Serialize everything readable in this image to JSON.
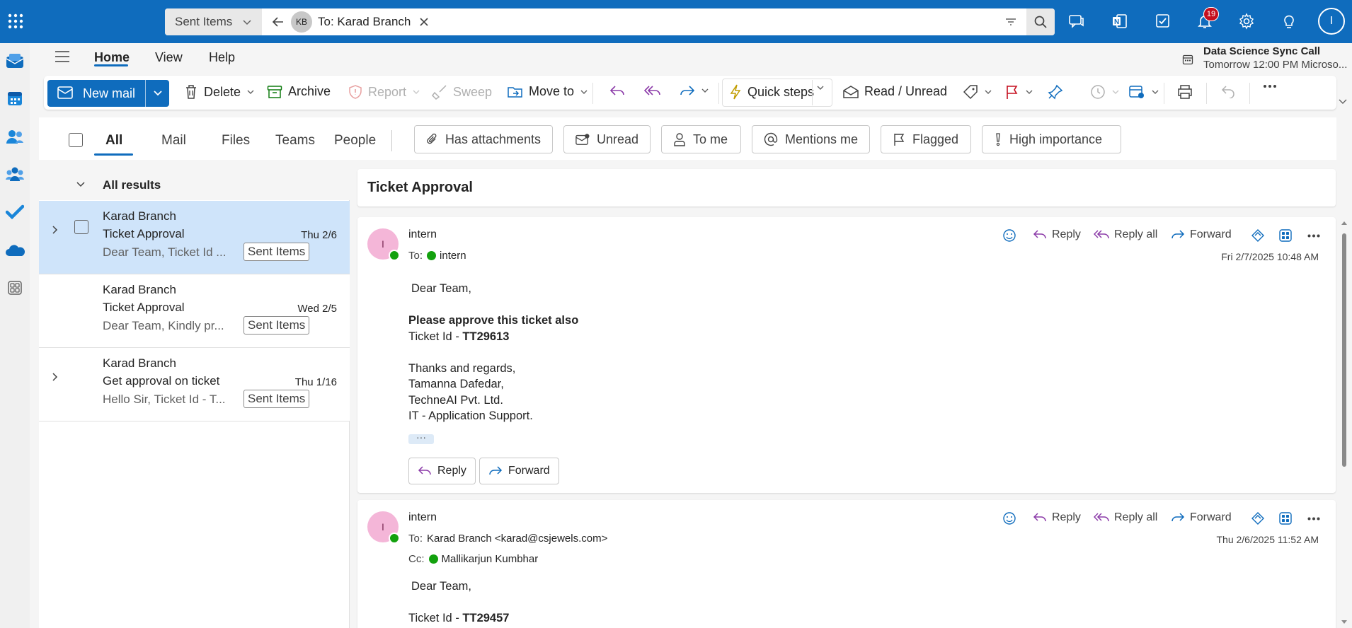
{
  "search": {
    "scope": "Sent Items",
    "chip_initials": "KB",
    "chip_label": "To: Karad Branch"
  },
  "notifications": {
    "count": "19"
  },
  "account": {
    "initial": "I"
  },
  "ribbon_tabs": [
    "Home",
    "View",
    "Help"
  ],
  "meeting": {
    "title": "Data Science Sync Call",
    "time": "Tomorrow 12:00 PM Microso..."
  },
  "ribbon": {
    "new_mail": "New mail",
    "delete": "Delete",
    "archive": "Archive",
    "report": "Report",
    "sweep": "Sweep",
    "move_to": "Move to",
    "quick_steps": "Quick steps",
    "read_unread": "Read / Unread"
  },
  "filter_tabs": [
    "All",
    "Mail",
    "Files",
    "Teams",
    "People"
  ],
  "filter_pills": [
    "Has attachments",
    "Unread",
    "To me",
    "Mentions me",
    "Flagged",
    "High importance"
  ],
  "list": {
    "header": "All results",
    "items": [
      {
        "from": "Karad Branch",
        "subject": "Ticket Approval",
        "date": "Thu 2/6",
        "preview": "Dear Team, Ticket Id ...",
        "folder": "Sent Items",
        "selected": true
      },
      {
        "from": "Karad Branch",
        "subject": "Ticket Approval",
        "date": "Wed 2/5",
        "preview": "Dear Team, Kindly pr...",
        "folder": "Sent Items",
        "selected": false
      },
      {
        "from": "Karad Branch",
        "subject": "Get approval on ticket",
        "date": "Thu 1/16",
        "preview": "Hello Sir, Ticket Id - T...",
        "folder": "Sent Items",
        "selected": false
      }
    ]
  },
  "reading": {
    "subject": "Ticket Approval",
    "actions": {
      "reply": "Reply",
      "reply_all": "Reply all",
      "forward": "Forward"
    },
    "messages": [
      {
        "avatar": "I",
        "sender": "intern",
        "to_label": "To:",
        "to": "intern",
        "timestamp": "Fri 2/7/2025 10:48 AM",
        "greeting": "Dear Team,",
        "line1": "Please approve this ticket also",
        "ticket_prefix": "Ticket Id - ",
        "ticket_id": "TT29613",
        "sig1": "Thanks and regards,",
        "sig2": "Tamanna Dafedar,",
        "sig3": "TechneAI Pvt. Ltd.",
        "sig4": "IT - Application Support.",
        "ellipsis": "···",
        "btn_reply": "Reply",
        "btn_forward": "Forward"
      },
      {
        "avatar": "I",
        "sender": "intern",
        "to_label": "To:",
        "to": "Karad Branch <karad@csjewels.com>",
        "cc_label": "Cc:",
        "cc": "Mallikarjun Kumbhar",
        "timestamp": "Thu 2/6/2025 11:52 AM",
        "greeting": "Dear Team,",
        "ticket_prefix": "Ticket Id - ",
        "ticket_id": "TT29457"
      }
    ]
  },
  "colors": {
    "brand": "#0f6cbd",
    "selected_row": "#cfe4fa",
    "avatar_bg": "#f4b6d8",
    "presence": "#13a10e",
    "badge": "#c50f1f"
  }
}
